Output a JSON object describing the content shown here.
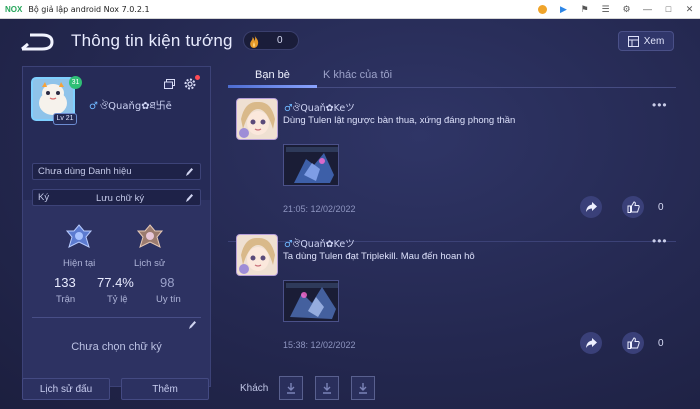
{
  "window": {
    "logo": "NOX",
    "title": "Bộ giả lập android Nox 7.0.2.1"
  },
  "header": {
    "title": "Thông tin kiện tướng",
    "points": "0",
    "view_button": "Xem"
  },
  "profile": {
    "level": "Lv 21",
    "rank_badge": "31",
    "gender_symbol": "♂",
    "name": "ঔQuaňg✿ཐ卐ē",
    "title_field": "Chưa dùng Danh hiệu",
    "sign_label": "Ký",
    "sign_value": "Lưu chữ ký",
    "stats": {
      "current_label": "Hiện tại",
      "history_label": "Lịch sử",
      "matches_value": "133",
      "matches_label": "Trận",
      "rate_value": "77.4%",
      "rate_label": "Tỷ lệ",
      "prestige_value": "98",
      "prestige_label": "Uy tín"
    },
    "motto": "Chưa chọn chữ ký"
  },
  "bottom_buttons": {
    "history": "Lịch sử đấu",
    "more": "Thêm"
  },
  "tabs": [
    {
      "label": "Bạn bè",
      "active": true
    },
    {
      "label": "K khác của tôi",
      "active": false
    }
  ],
  "posts": [
    {
      "gender_symbol": "♂",
      "author": "ঔQuaň✿Keツ",
      "text": "Dùng Tulen lật ngược bàn thua, xứng đáng phong thần",
      "time": "21:05: 12/02/2022",
      "likes": "0",
      "more": "•••"
    },
    {
      "gender_symbol": "♂",
      "author": "ঔQuaň✿Keツ",
      "text": "Ta dùng Tulen đạt Triplekill. Mau đến hoan hô",
      "time": "15:38: 12/02/2022",
      "likes": "0",
      "more": "•••"
    }
  ],
  "guests": {
    "label": "Khách"
  },
  "colors": {
    "background": "#22264a",
    "panel": "#2d3262",
    "accent": "#6c8bd1",
    "flame": "#e59a2a"
  }
}
